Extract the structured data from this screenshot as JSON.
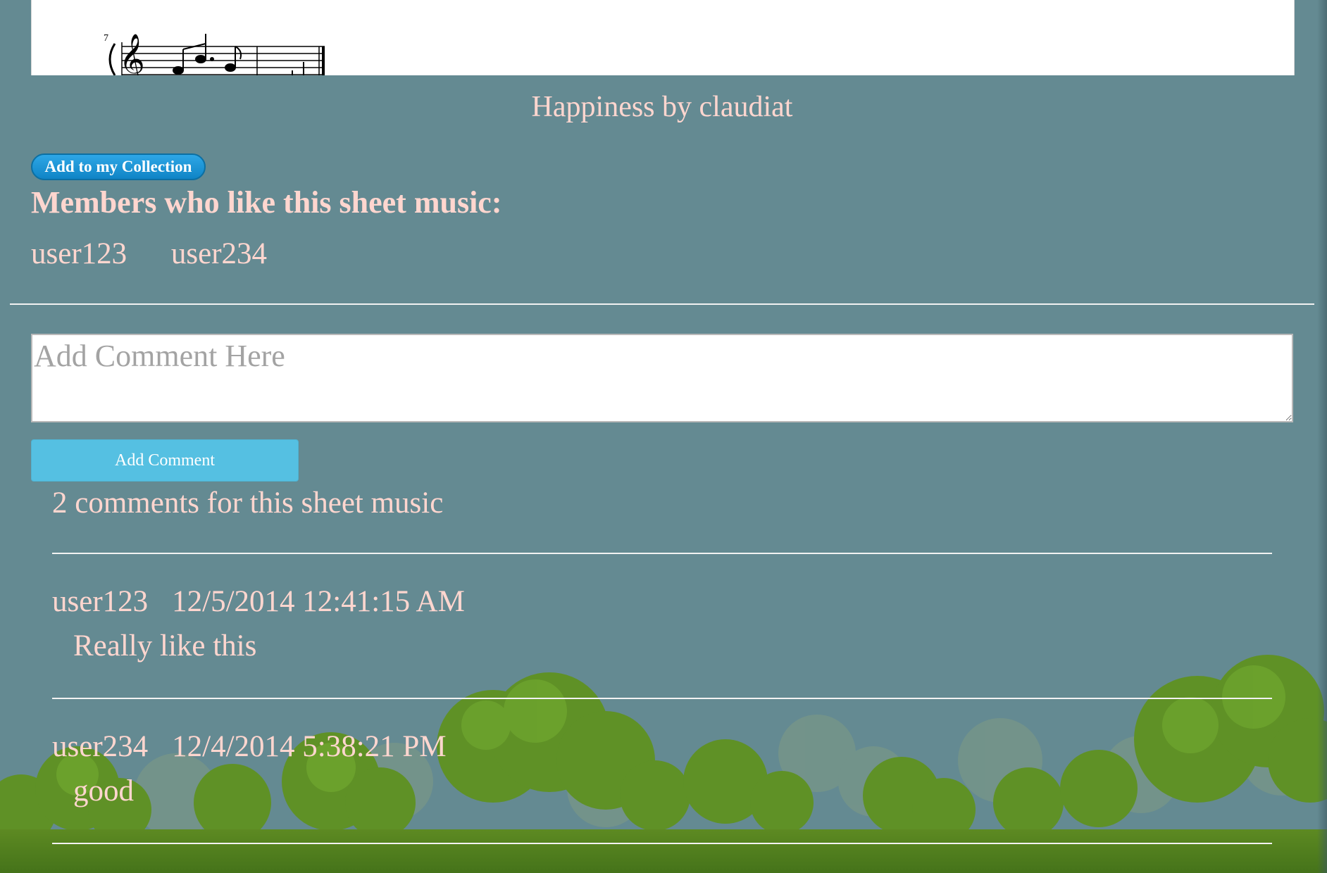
{
  "page": {
    "title": "Happiness by claudiat",
    "sheet": {
      "measure_number": "7"
    }
  },
  "actions": {
    "add_to_collection_label": "Add to my Collection",
    "add_comment_label": "Add Comment"
  },
  "members": {
    "heading": "Members who like this sheet music:",
    "users": [
      "user123",
      "user234"
    ]
  },
  "comment_form": {
    "placeholder": "Add Comment Here"
  },
  "comments": {
    "count_text": "2 comments for this sheet music",
    "items": [
      {
        "user": "user123",
        "date": "12/5/2014 12:41:15 AM",
        "text": "Really like this"
      },
      {
        "user": "user234",
        "date": "12/4/2014 5:38:21 PM",
        "text": "good"
      }
    ]
  },
  "colors": {
    "background": "#648a92",
    "text": "#ffd6cf",
    "button_primary": "#1592d3",
    "button_secondary": "#55c0e2",
    "grass": "#4f7f1b"
  }
}
